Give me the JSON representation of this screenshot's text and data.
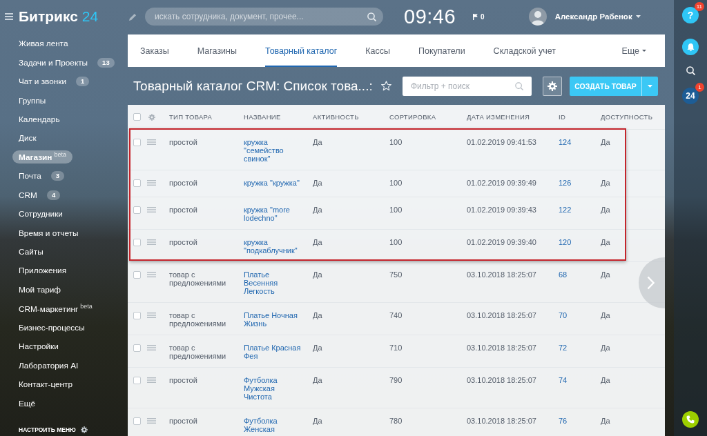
{
  "header": {
    "logo": {
      "name": "Битрикс",
      "number": "24"
    },
    "search": {
      "placeholder": "искать сотрудника, документ, прочее..."
    },
    "clock": "09:46",
    "flags": "0",
    "user": {
      "name": "Александр Рабенок"
    }
  },
  "sidebar": {
    "items": [
      {
        "label": "Живая лента",
        "selected": false
      },
      {
        "label": "Задачи и Проекты",
        "counter": "13",
        "selected": false
      },
      {
        "label": "Чат и звонки",
        "counter": "1",
        "selected": false
      },
      {
        "label": "Группы",
        "selected": false
      },
      {
        "label": "Календарь",
        "selected": false
      },
      {
        "label": "Диск",
        "selected": false
      },
      {
        "label": "Магазин",
        "tag": "beta",
        "selected": true
      },
      {
        "label": "Почта",
        "counter": "3",
        "selected": false
      },
      {
        "label": "CRM",
        "counter": "4",
        "selected": false
      },
      {
        "label": "Сотрудники",
        "selected": false
      },
      {
        "label": "Время и отчеты",
        "selected": false
      },
      {
        "label": "Сайты",
        "selected": false
      },
      {
        "label": "Приложения",
        "selected": false
      },
      {
        "label": "Мой тариф",
        "selected": false
      },
      {
        "label": "CRM-маркетинг",
        "tag": "beta",
        "selected": false
      },
      {
        "label": "Бизнес-процессы",
        "selected": false
      },
      {
        "label": "Настройки",
        "selected": false
      },
      {
        "label": "Лаборатория AI",
        "selected": false
      },
      {
        "label": "Контакт-центр",
        "selected": false
      },
      {
        "label": "Ещё",
        "selected": false
      }
    ],
    "configure": "НАСТРОИТЬ МЕНЮ"
  },
  "tabs": [
    {
      "label": "Заказы",
      "selected": false
    },
    {
      "label": "Магазины",
      "selected": false
    },
    {
      "label": "Товарный каталог",
      "selected": true
    },
    {
      "label": "Кассы",
      "selected": false
    },
    {
      "label": "Покупатели",
      "selected": false
    },
    {
      "label": "Складской учет",
      "selected": false
    }
  ],
  "tabs_more": "Еще",
  "page": {
    "title": "Товарный каталог CRM: Список това...:",
    "starred": false,
    "filter": {
      "placeholder": "Фильтр + поиск"
    },
    "create_button": "СОЗДАТЬ ТОВАР"
  },
  "table": {
    "all_checked": false,
    "columns": [
      {
        "label": "ТИП ТОВАРА",
        "kind": "text"
      },
      {
        "label": "НАЗВАНИЕ",
        "kind": "name"
      },
      {
        "label": "АКТИВНОСТЬ",
        "kind": "text"
      },
      {
        "label": "СОРТИРОВКА",
        "kind": "text"
      },
      {
        "label": "ДАТА ИЗМЕНЕНИЯ",
        "kind": "text"
      },
      {
        "label": "ID",
        "kind": "id"
      },
      {
        "label": "ДОСТУПНОСТЬ",
        "kind": "text"
      }
    ],
    "rows": [
      {
        "cells": [
          "простой",
          "кружка \"семейство свинок\"",
          "Да",
          "100",
          "01.02.2019 09:41:53",
          "124",
          "Да"
        ],
        "checked": false,
        "highlighted": true
      },
      {
        "cells": [
          "простой",
          "кружка \"кружка\"",
          "Да",
          "100",
          "01.02.2019 09:39:49",
          "126",
          "Да"
        ],
        "checked": false,
        "highlighted": true
      },
      {
        "cells": [
          "простой",
          "кружка \"more lodechno\"",
          "Да",
          "100",
          "01.02.2019 09:39:43",
          "122",
          "Да"
        ],
        "checked": false,
        "highlighted": true
      },
      {
        "cells": [
          "простой",
          "кружка \"подкаблучник\"",
          "Да",
          "100",
          "01.02.2019 09:39:40",
          "120",
          "Да"
        ],
        "checked": false,
        "highlighted": true
      },
      {
        "cells": [
          "товар с предложениями",
          "Платье Весенняя Легкость",
          "Да",
          "750",
          "03.10.2018 18:25:07",
          "68",
          "Да"
        ],
        "checked": false,
        "highlighted": false
      },
      {
        "cells": [
          "товар с предложениями",
          "Платье Ночная Жизнь",
          "Да",
          "740",
          "03.10.2018 18:25:07",
          "70",
          "Да"
        ],
        "checked": false,
        "highlighted": false
      },
      {
        "cells": [
          "товар с предложениями",
          "Платье Красная Фея",
          "Да",
          "710",
          "03.10.2018 18:25:07",
          "72",
          "Да"
        ],
        "checked": false,
        "highlighted": false
      },
      {
        "cells": [
          "простой",
          "Футболка Мужская Чистота",
          "Да",
          "790",
          "03.10.2018 18:25:07",
          "74",
          "Да"
        ],
        "checked": false,
        "highlighted": false
      },
      {
        "cells": [
          "простой",
          "Футболка Женская",
          "Да",
          "780",
          "03.10.2018 18:25:07",
          "76",
          "Да"
        ],
        "checked": false,
        "highlighted": false
      }
    ]
  },
  "right_panel": {
    "help": {
      "glyph": "?",
      "counter": "11"
    },
    "apps": {
      "logo": "24",
      "counter": "1"
    }
  }
}
